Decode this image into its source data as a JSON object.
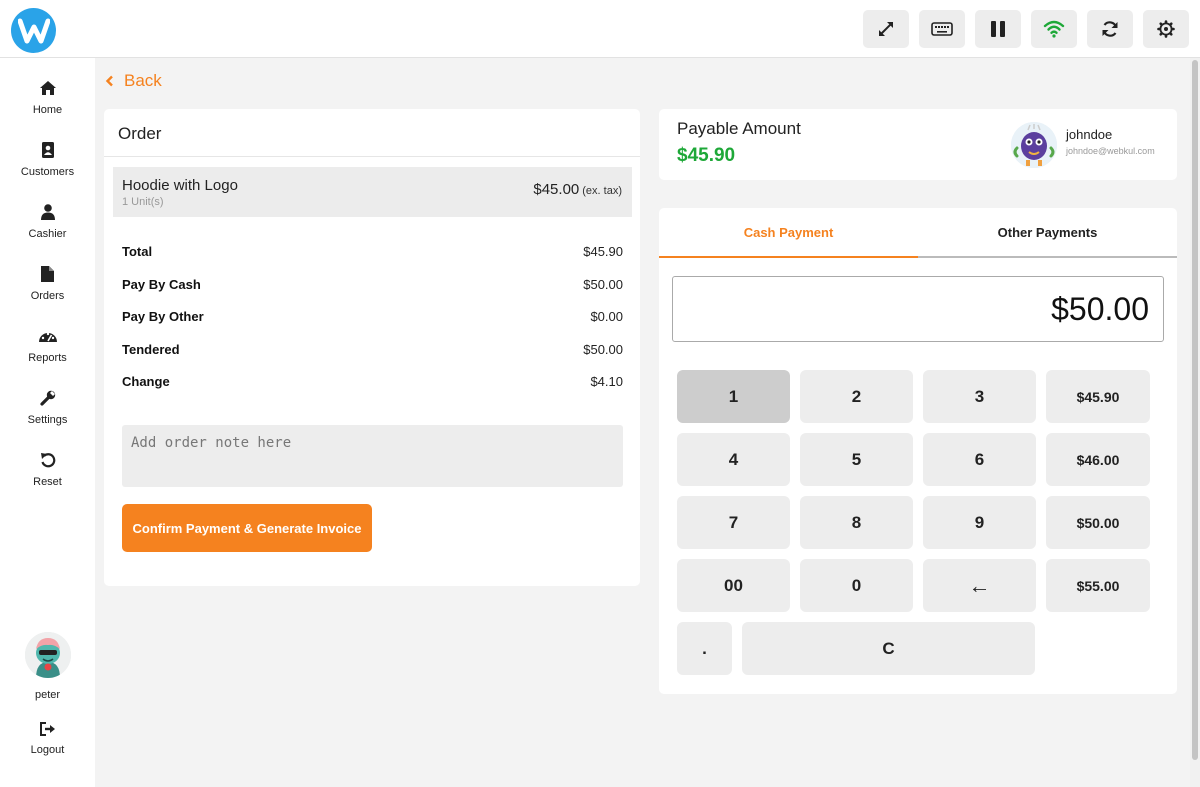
{
  "app": {
    "logo_letter": "W"
  },
  "toolbar": {
    "buttons": [
      {
        "icon": "expand-icon"
      },
      {
        "icon": "keyboard-icon"
      },
      {
        "icon": "pause-icon"
      },
      {
        "icon": "wifi-icon",
        "color": "#1ea838"
      },
      {
        "icon": "refresh-icon"
      },
      {
        "icon": "gear-icon"
      }
    ]
  },
  "sidebar": {
    "items": [
      {
        "label": "Home",
        "icon": "home-icon"
      },
      {
        "label": "Customers",
        "icon": "address-book-icon"
      },
      {
        "label": "Cashier",
        "icon": "user-icon"
      },
      {
        "label": "Orders",
        "icon": "file-icon"
      },
      {
        "label": "Reports",
        "icon": "dashboard-icon"
      },
      {
        "label": "Settings",
        "icon": "wrench-icon"
      },
      {
        "label": "Reset",
        "icon": "undo-icon"
      }
    ],
    "user": {
      "name": "peter"
    },
    "logout_label": "Logout"
  },
  "back_label": "Back",
  "order": {
    "title": "Order",
    "item": {
      "name": "Hoodie with Logo",
      "units": "1 Unit(s)",
      "price": "$45.00",
      "tax_note": "(ex. tax)"
    },
    "summary": [
      {
        "label": "Total",
        "value": "$45.90"
      },
      {
        "label": "Pay By Cash",
        "value": "$50.00"
      },
      {
        "label": "Pay By Other",
        "value": "$0.00"
      },
      {
        "label": "Tendered",
        "value": "$50.00"
      },
      {
        "label": "Change",
        "value": "$4.10"
      }
    ],
    "note_placeholder": "Add order note here",
    "confirm_label": "Confirm Payment & Generate Invoice"
  },
  "payable": {
    "label": "Payable Amount",
    "amount": "$45.90",
    "customer": {
      "name": "johndoe",
      "email": "johndoe@webkul.com"
    }
  },
  "payment": {
    "tabs": [
      {
        "label": "Cash Payment",
        "active": true
      },
      {
        "label": "Other Payments",
        "active": false
      }
    ],
    "display_amount": "$50.00",
    "keys": [
      "1",
      "2",
      "3",
      "4",
      "5",
      "6",
      "7",
      "8",
      "9",
      "00",
      "0",
      "←",
      ".",
      "C"
    ],
    "quick_amounts": [
      "$45.90",
      "$46.00",
      "$50.00",
      "$55.00"
    ]
  },
  "colors": {
    "accent": "#f5821f",
    "success": "#1ea838",
    "brand": "#2aa3e8"
  }
}
